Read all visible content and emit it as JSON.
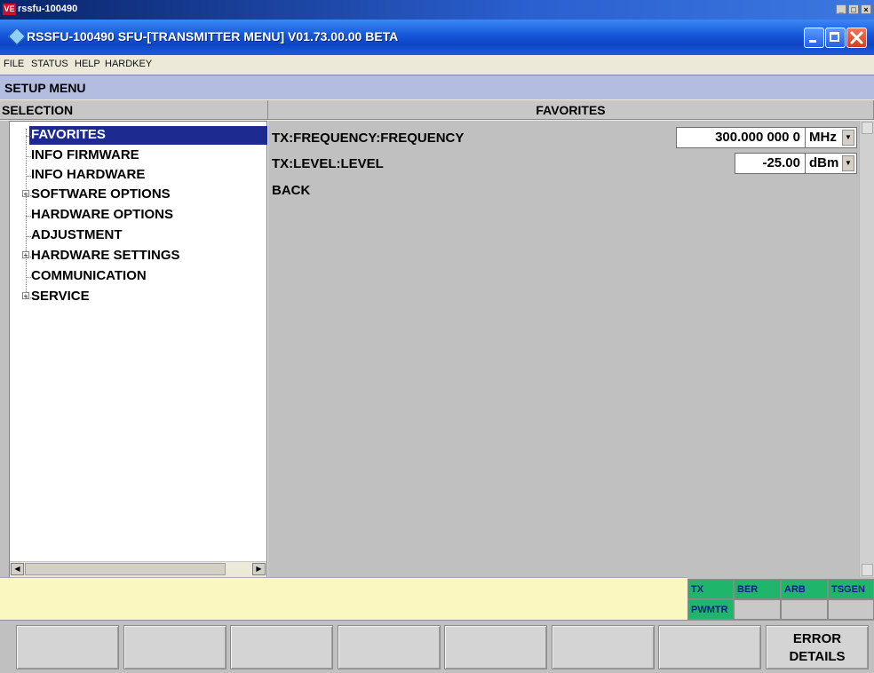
{
  "outer_window": {
    "icon_text": "VE",
    "title": "rssfu-100490"
  },
  "app": {
    "title": "RSSFU-100490  SFU-[TRANSMITTER MENU]  V01.73.00.00 BETA"
  },
  "menubar": {
    "items": [
      "FILE",
      "STATUS",
      "HELP",
      "HARDKEY"
    ]
  },
  "setup": {
    "title": "SETUP MENU"
  },
  "selection": {
    "header": "SELECTION",
    "items": [
      {
        "label": "FAVORITES",
        "selected": true,
        "expandable": false
      },
      {
        "label": "INFO FIRMWARE",
        "selected": false,
        "expandable": false
      },
      {
        "label": "INFO HARDWARE",
        "selected": false,
        "expandable": false
      },
      {
        "label": "SOFTWARE OPTIONS",
        "selected": false,
        "expandable": true
      },
      {
        "label": "HARDWARE OPTIONS",
        "selected": false,
        "expandable": false
      },
      {
        "label": "ADJUSTMENT",
        "selected": false,
        "expandable": false
      },
      {
        "label": "HARDWARE SETTINGS",
        "selected": false,
        "expandable": true
      },
      {
        "label": "COMMUNICATION",
        "selected": false,
        "expandable": false
      },
      {
        "label": "SERVICE",
        "selected": false,
        "expandable": true
      }
    ]
  },
  "favorites": {
    "header": "FAVORITES",
    "params": [
      {
        "label": "TX:FREQUENCY:FREQUENCY",
        "value": "300.000 000 0",
        "unit": "MHz"
      },
      {
        "label": "TX:LEVEL:LEVEL",
        "value": "-25.00",
        "unit": "dBm"
      }
    ],
    "back_label": "BACK"
  },
  "indicators": [
    {
      "label": "TX",
      "active": true
    },
    {
      "label": "BER",
      "active": true
    },
    {
      "label": "ARB",
      "active": true
    },
    {
      "label": "TSGEN",
      "active": true
    },
    {
      "label": "PWMTR",
      "active": true
    },
    {
      "label": "",
      "active": false
    },
    {
      "label": "",
      "active": false
    },
    {
      "label": "",
      "active": false
    }
  ],
  "softkeys": [
    "",
    "",
    "",
    "",
    "",
    "",
    "",
    "ERROR\nDETAILS"
  ],
  "colors": {
    "selected_bg": "#1d2a8f",
    "indicator_active": "#1fb56a",
    "status_bg": "#fbf7c0",
    "header_band": "#b3bde0"
  },
  "icons": {
    "app": "rohde-diamond-icon",
    "expand": "plus-box-icon",
    "dropdown": "chevron-down-icon"
  }
}
